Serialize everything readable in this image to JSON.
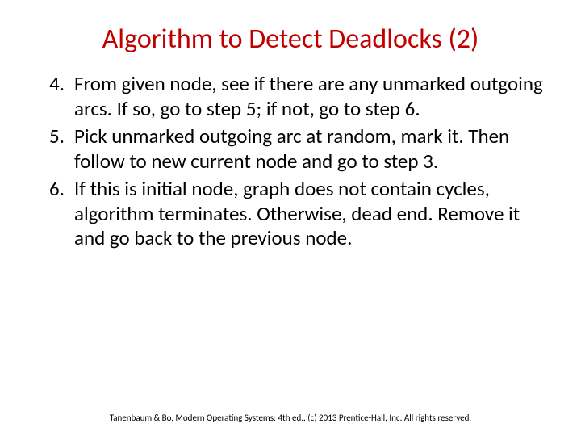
{
  "title": "Algorithm to Detect Deadlocks (2)",
  "items": [
    {
      "num": "4.",
      "text": "From given node, see if there are any unmarked outgoing arcs. If so, go to step 5; if not, go to step 6."
    },
    {
      "num": "5.",
      "text": "Pick unmarked outgoing arc at random, mark it. Then follow to new current node and go to step 3."
    },
    {
      "num": "6.",
      "text": "If this is initial node, graph does not contain cycles, algorithm terminates. Otherwise, dead end. Remove it and go back to the previous node."
    }
  ],
  "footer": "Tanenbaum & Bo, Modern Operating Systems: 4th ed., (c) 2013 Prentice-Hall, Inc. All rights reserved."
}
